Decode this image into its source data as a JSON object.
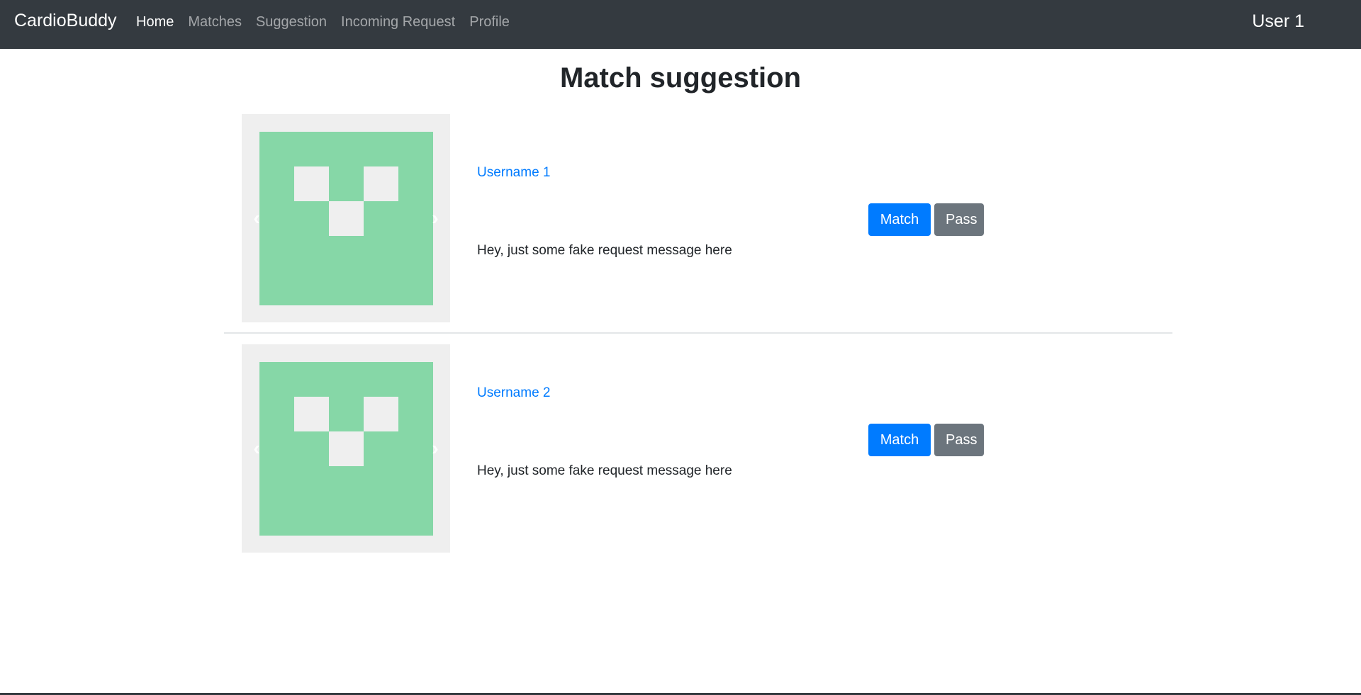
{
  "navbar": {
    "brand": "CardioBuddy",
    "links": [
      {
        "label": "Home",
        "active": true
      },
      {
        "label": "Matches",
        "active": false
      },
      {
        "label": "Suggestion",
        "active": false
      },
      {
        "label": "Incoming Request",
        "active": false
      },
      {
        "label": "Profile",
        "active": false
      }
    ],
    "user": "User 1"
  },
  "page": {
    "title": "Match suggestion"
  },
  "suggestions": [
    {
      "username": "Username 1",
      "message": "Hey, just some fake request message here",
      "match_label": "Match",
      "pass_label": "Pass",
      "prev_icon": "chevron-left-icon",
      "next_icon": "chevron-right-icon"
    },
    {
      "username": "Username 2",
      "message": "Hey, just some fake request message here",
      "match_label": "Match",
      "pass_label": "Pass",
      "prev_icon": "chevron-left-icon",
      "next_icon": "chevron-right-icon"
    }
  ],
  "colors": {
    "navbar_bg": "#343a40",
    "primary": "#007bff",
    "secondary": "#6c757d",
    "avatar_green": "#86d7a7",
    "avatar_light": "#efefef"
  }
}
